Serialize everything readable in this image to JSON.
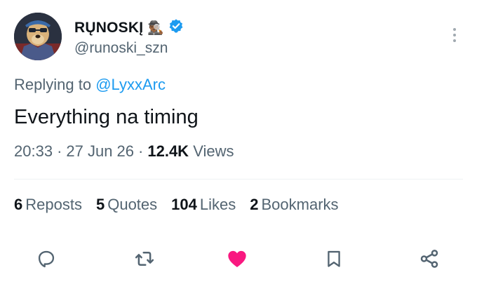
{
  "author": {
    "display_name": "RŲNOSKĮ",
    "emoji": "🕵🏾‍♂️",
    "handle": "@runoski_szn",
    "verified": true
  },
  "reply": {
    "prefix": "Replying to",
    "mention": "@LyxxArc"
  },
  "tweet": {
    "text": "Everything na timing",
    "time": "20:33",
    "date": "27 Jun 26",
    "views_count": "12.4K",
    "views_label": "Views"
  },
  "stats": [
    {
      "count": "6",
      "label": "Reposts"
    },
    {
      "count": "5",
      "label": "Quotes"
    },
    {
      "count": "104",
      "label": "Likes"
    },
    {
      "count": "2",
      "label": "Bookmarks"
    }
  ],
  "colors": {
    "accent": "#1d9bf0",
    "like": "#f91880",
    "muted": "#536471",
    "text": "#0f1419"
  },
  "icons": {
    "reply": "reply-icon",
    "repost": "repost-icon",
    "like": "heart-icon",
    "bookmark": "bookmark-icon",
    "share": "share-icon"
  }
}
